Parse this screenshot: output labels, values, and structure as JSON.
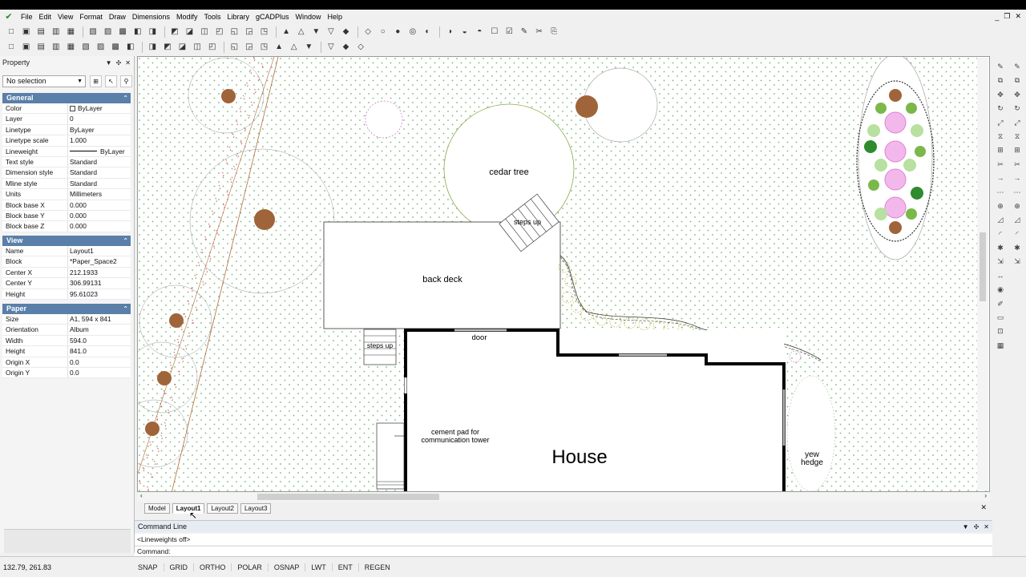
{
  "menu": [
    "File",
    "Edit",
    "View",
    "Format",
    "Draw",
    "Dimensions",
    "Modify",
    "Tools",
    "Library",
    "gCADPlus",
    "Window",
    "Help"
  ],
  "icons": {
    "app": "gcad-logo-icon",
    "toolbar1": [
      "new-file-icon",
      "open-file-icon",
      "save-icon",
      "add-icon",
      "print-icon",
      "cut-icon",
      "copy-icon",
      "paste-icon",
      "undo-icon",
      "redo-icon",
      "zoom-in-icon",
      "zoom-out-icon",
      "zoom-window-icon",
      "zoom-extents-icon",
      "zoom-all-icon",
      "zoom-previous-icon",
      "zoom-realtime-icon",
      "properties-icon",
      "layer-icon",
      "layout-icon",
      "linetype-icon",
      "block-icon",
      "insert-icon",
      "image-icon",
      "book-icon",
      "match-icon",
      "palette-icon",
      "bars-icon",
      "hatch-icon",
      "text-icon",
      "attribute-icon",
      "table-icon",
      "field-icon",
      "eraser-icon",
      "cadplus-icon"
    ],
    "toolbar2": [
      "point-icon",
      "line-icon",
      "xline-icon",
      "polyline-icon",
      "spline-icon",
      "rectangle-icon",
      "circle-icon",
      "ellipse-icon",
      "arc-icon",
      "measure-icon",
      "snap-icon",
      "tracking-icon",
      "grid-icon",
      "dimension-icon",
      "distance-icon",
      "angle-icon",
      "array-icon",
      "mirror-icon",
      "offset-icon",
      "align-icon",
      "arrow-icon",
      "plus-icon",
      "table-cell-icon"
    ],
    "right_col1": [
      "pencil-icon",
      "copy-obj-icon",
      "move-icon",
      "rotate-icon",
      "scale-icon",
      "mirror-obj-icon",
      "array-obj-icon",
      "trim-icon",
      "extend-icon",
      "break-icon",
      "join-icon",
      "chamfer-icon",
      "fillet-icon",
      "explode-icon",
      "stretch-icon",
      "lengthen-icon",
      "grip-icon",
      "pedit-icon",
      "block-edit-icon",
      "insert-block-icon",
      "group-icon"
    ],
    "right_col2": [
      "square-icon",
      "triangle-icon",
      "circle-tool-icon",
      "hexagon-icon",
      "cross-icon",
      "layer-tool-icon",
      "node-icon",
      "divide-icon",
      "spiral-icon",
      "hourglass-icon",
      "diamond-icon",
      "close-icon",
      "magnet-icon",
      "line-tool-icon",
      "hatch-tool-icon"
    ]
  },
  "window_controls": [
    "_",
    "❐",
    "✕"
  ],
  "property_panel": {
    "title": "Property",
    "selection": "No selection",
    "sections": [
      {
        "name": "General",
        "rows": [
          {
            "key": "Color",
            "value": "ByLayer",
            "swatch": "#ffffff"
          },
          {
            "key": "Layer",
            "value": "0"
          },
          {
            "key": "Linetype",
            "value": "ByLayer"
          },
          {
            "key": "Linetype scale",
            "value": "1.000"
          },
          {
            "key": "Lineweight",
            "value": "ByLayer",
            "line": true
          },
          {
            "key": "Text style",
            "value": "Standard"
          },
          {
            "key": "Dimension style",
            "value": "Standard"
          },
          {
            "key": "Mline style",
            "value": "Standard"
          },
          {
            "key": "Units",
            "value": "Millimeters"
          },
          {
            "key": "Block base X",
            "value": "0.000"
          },
          {
            "key": "Block base Y",
            "value": "0.000"
          },
          {
            "key": "Block base Z",
            "value": "0.000"
          }
        ]
      },
      {
        "name": "View",
        "rows": [
          {
            "key": "Name",
            "value": "Layout1"
          },
          {
            "key": "Block",
            "value": "*Paper_Space2"
          },
          {
            "key": "Center X",
            "value": "212.1933"
          },
          {
            "key": "Center Y",
            "value": "306.99131"
          },
          {
            "key": "Height",
            "value": "95.61023"
          }
        ]
      },
      {
        "name": "Paper",
        "rows": [
          {
            "key": "Size",
            "value": "A1, 594 x 841"
          },
          {
            "key": "Orientation",
            "value": "Album"
          },
          {
            "key": "Width",
            "value": "594.0"
          },
          {
            "key": "Height",
            "value": "841.0"
          },
          {
            "key": "Origin X",
            "value": "0.0"
          },
          {
            "key": "Origin Y",
            "value": "0.0"
          }
        ]
      }
    ]
  },
  "drawing": {
    "labels": {
      "cedar_tree": "cedar tree",
      "steps_up_top": "steps up",
      "back_deck": "back deck",
      "steps_up_left": "steps up",
      "door": "door",
      "cement_pad_1": "cement pad for",
      "cement_pad_2": "communication tower",
      "house": "House",
      "yew": "yew",
      "hedge": "hedge"
    },
    "colors": {
      "tree": "#a0643a",
      "shrub_red": "#d03030",
      "flower_pink": "#e080d0",
      "green_dots": "#6fba6f",
      "dark_green": "#2e8b2e"
    }
  },
  "layout_tabs": [
    {
      "label": "Model",
      "active": false
    },
    {
      "label": "Layout1",
      "active": true
    },
    {
      "label": "Layout2",
      "active": false
    },
    {
      "label": "Layout3",
      "active": false
    }
  ],
  "command_line": {
    "title": "Command Line",
    "history": "<Lineweights off>",
    "prompt": "Command:",
    "input": ""
  },
  "status_bar": {
    "coords": "132.79, 261.83",
    "buttons": [
      "SNAP",
      "GRID",
      "ORTHO",
      "POLAR",
      "OSNAP",
      "LWT",
      "ENT",
      "REGEN"
    ]
  }
}
